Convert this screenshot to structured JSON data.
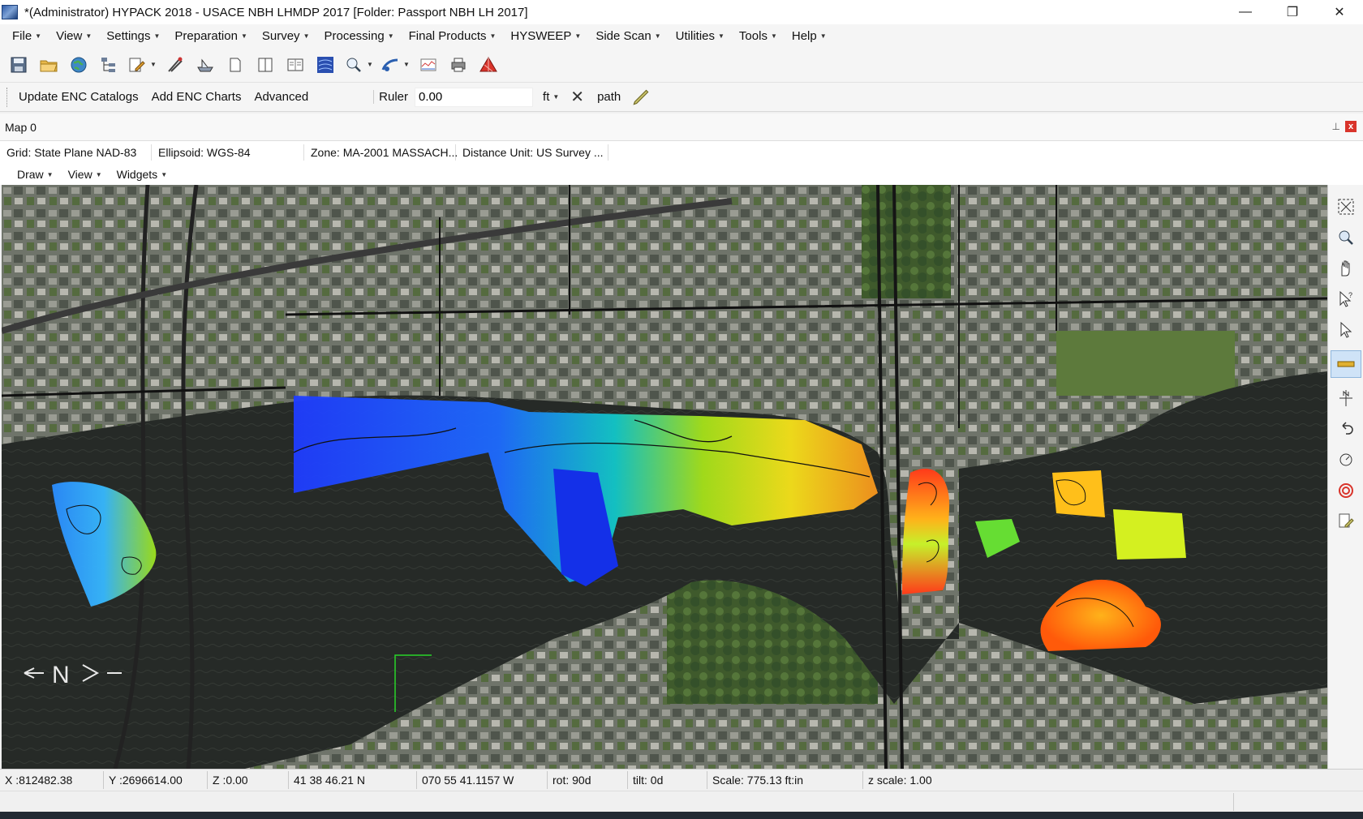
{
  "window": {
    "title": "*(Administrator) HYPACK 2018 - USACE NBH LHMDP 2017  [Folder: Passport NBH LH 2017]",
    "minimize_glyph": "—",
    "maximize_glyph": "❐",
    "close_glyph": "✕"
  },
  "menubar": {
    "items": [
      "File",
      "View",
      "Settings",
      "Preparation",
      "Survey",
      "Processing",
      "Final Products",
      "HYSWEEP",
      "Side Scan",
      "Utilities",
      "Tools",
      "Help"
    ]
  },
  "toolbar": {
    "icons": [
      "save-icon",
      "open-folder-icon",
      "globe-icon",
      "project-tree-icon",
      "edit-dropdown-icon",
      "survey-tool-icon",
      "boat-icon",
      "page-icon",
      "book-icon",
      "book-open-icon",
      "sidescan-icon",
      "magnifier-dropdown-icon",
      "sonar-dropdown-icon",
      "chart-icon",
      "printer-icon",
      "tin-model-icon"
    ]
  },
  "toolbar2": {
    "update_enc": "Update ENC Catalogs",
    "add_enc": "Add ENC Charts",
    "advanced": "Advanced",
    "ruler_label": "Ruler",
    "ruler_value": "0.00",
    "unit": "ft",
    "path_label": "path"
  },
  "map_doc": {
    "title": "Map 0",
    "pin_glyph": "⊥",
    "close_glyph": "x",
    "info": {
      "grid": "Grid: State Plane NAD-83",
      "ellipsoid": "Ellipsoid: WGS-84",
      "zone": "Zone: MA-2001 MASSACH...",
      "distance_unit": "Distance Unit: US Survey ..."
    },
    "menu": [
      "Draw",
      "View",
      "Widgets"
    ],
    "north_arrow_text": "N"
  },
  "side_tools": [
    "zoom-extents-icon",
    "zoom-window-icon",
    "pan-hand-icon",
    "select-query-icon",
    "pointer-icon",
    "ruler-measure-icon",
    "north-up-icon",
    "undo-icon",
    "scale-icon",
    "target-icon",
    "edit-page-icon"
  ],
  "colors": {
    "accent_close": "#d9342b",
    "active_tool": "#cfe3f7"
  },
  "status": {
    "x": "X :812482.38",
    "y": "Y :2696614.00",
    "z": "Z :0.00",
    "lat": "41 38 46.21 N",
    "lon": "070 55 41.1157 W",
    "rot": "rot:  90d",
    "tilt": "tilt:   0d",
    "scale": "Scale: 775.13 ft:in",
    "zscale": "z scale: 1.00"
  }
}
